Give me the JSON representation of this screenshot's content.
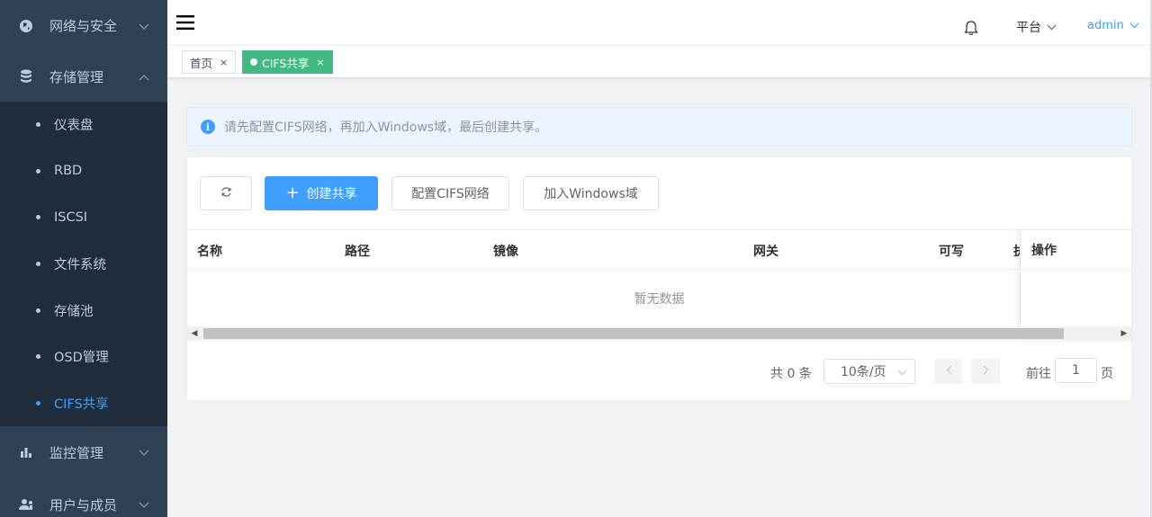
{
  "sidebar": {
    "menus": [
      {
        "label": "网络与安全",
        "icon": "globe-icon"
      },
      {
        "label": "存储管理",
        "icon": "database-icon"
      },
      {
        "label": "监控管理",
        "icon": "bar-chart-icon"
      },
      {
        "label": "用户与成员",
        "icon": "users-icon"
      }
    ],
    "storage_items": [
      "仪表盘",
      "RBD",
      "ISCSI",
      "文件系统",
      "存储池",
      "OSD管理",
      "CIFS共享"
    ],
    "active_item": "CIFS共享"
  },
  "header": {
    "platform_label": "平台",
    "user_label": "admin"
  },
  "tags": [
    {
      "label": "首页",
      "active": false
    },
    {
      "label": "CIFS共享",
      "active": true
    }
  ],
  "alert": {
    "text": "请先配置CIFS网络，再加入Windows域，最后创建共享。"
  },
  "toolbar": {
    "create_label": "创建共享",
    "config_label": "配置CIFS网络",
    "join_label": "加入Windows域"
  },
  "table": {
    "columns": [
      "名称",
      "路径",
      "镜像",
      "网关",
      "可写",
      "执"
    ],
    "fixed_column": "操作",
    "empty_text": "暂无数据"
  },
  "pagination": {
    "total_text": "共 0 条",
    "page_size": "10条/页",
    "goto_label": "前往",
    "current_page": "1",
    "page_unit": "页"
  },
  "colors": {
    "sidebar_bg": "#304156",
    "submenu_bg": "#1f2d3d",
    "primary": "#409eff",
    "tag_active": "#42b983"
  }
}
